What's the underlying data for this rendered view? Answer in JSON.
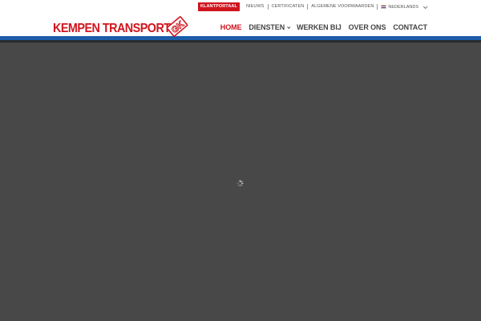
{
  "topbar": {
    "links": [
      "Klantportaal",
      "Nieuws",
      "Certificaten",
      "Algemene voorwaarden"
    ],
    "language": "Nederlands"
  },
  "header": {
    "logo_text": "KEMPEN TRANSPORT",
    "logo_mark": "GK"
  },
  "nav": {
    "items": [
      "HOME",
      "DIENSTEN",
      "WERKEN BIJ",
      "OVER ONS",
      "CONTACT"
    ],
    "active": "HOME"
  },
  "colors": {
    "brand_red": "#d0151e",
    "brand_blue": "#1c5ca9",
    "overlay": "#484848"
  }
}
